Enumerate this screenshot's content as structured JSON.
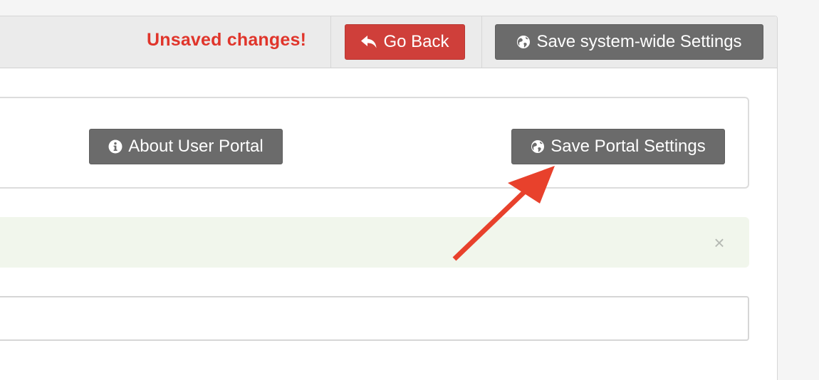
{
  "topbar": {
    "status_text": "Unsaved changes!",
    "go_back_label": "Go Back",
    "save_system_label": "Save system-wide Settings"
  },
  "portal": {
    "about_label": "About User Portal",
    "save_label": "Save Portal Settings"
  },
  "alert": {
    "close_glyph": "×"
  },
  "colors": {
    "danger": "#cf3f3a",
    "status_text": "#e0352b",
    "button_gray": "#6b6b6b",
    "alert_bg": "#f1f6ec",
    "annotation_arrow": "#e8412c"
  },
  "icons": {
    "go_back": "reply-icon",
    "save_system": "globe-icon",
    "about": "info-circle-icon",
    "save_portal": "globe-icon",
    "alert_close": "close-icon"
  }
}
